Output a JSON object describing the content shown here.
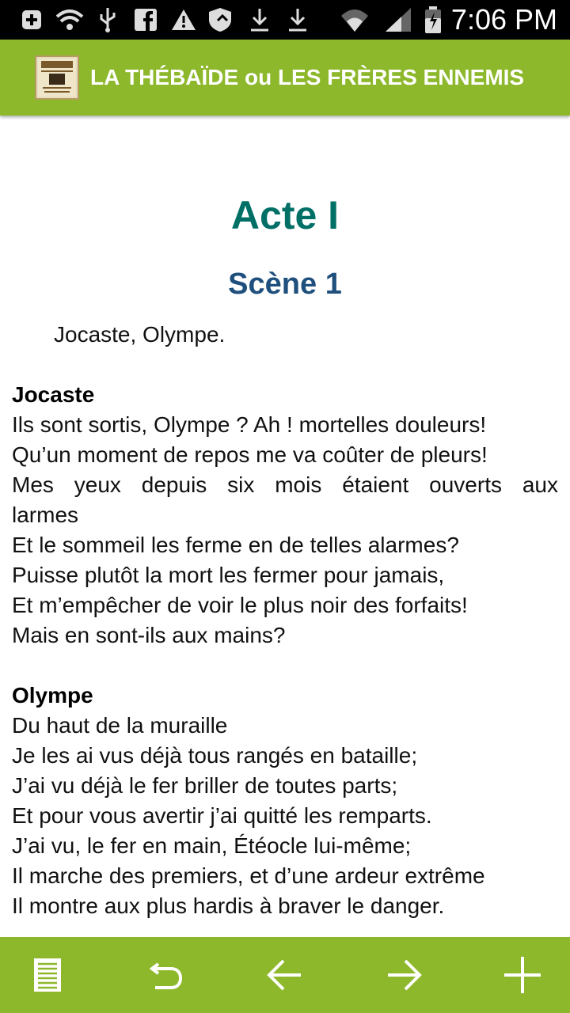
{
  "status_bar": {
    "time": "7:06 PM",
    "icons": [
      "plus-notification-icon",
      "wifi-hotspot-icon",
      "usb-icon",
      "facebook-icon",
      "warning-icon",
      "shield-icon",
      "download-icon",
      "download-icon",
      "wifi-icon",
      "signal-icon",
      "battery-icon"
    ]
  },
  "app_bar": {
    "title": "LA THÉBAÏDE ou LES FRÈRES ENNEMIS",
    "icon": "book-cover-icon"
  },
  "content": {
    "act": "Acte I",
    "scene": "Scène 1",
    "cast": "Jocaste, Olympe.",
    "speeches": [
      {
        "speaker": "Jocaste",
        "lines": [
          "Ils sont sortis, Olympe ? Ah ! mortelles douleurs!",
          "Qu’un moment de repos me va coûter de pleurs!",
          "Mes yeux depuis six mois étaient ouverts aux",
          "larmes",
          "Et le sommeil les ferme en de telles alarmes?",
          "Puisse plutôt la mort les fermer pour jamais,",
          "Et m’empêcher de voir le plus noir des forfaits!",
          "Mais en sont-ils aux mains?"
        ]
      },
      {
        "speaker": "Olympe",
        "lines": [
          "Du haut de la muraille",
          "Je les ai vus déjà tous rangés en bataille;",
          "J’ai vu déjà le fer briller de toutes parts;",
          "Et pour vous avertir j’ai quitté les remparts.",
          "J’ai vu, le fer en main, Étéocle lui-même;",
          "Il marche des premiers, et d’une ardeur extrême",
          "Il montre aux plus hardis à braver le danger."
        ]
      }
    ]
  },
  "bottom_bar": {
    "buttons": [
      "contents-icon",
      "undo-icon",
      "arrow-left-icon",
      "arrow-right-icon",
      "plus-icon"
    ]
  },
  "colors": {
    "accent": "#8db82c",
    "act_title": "#007066",
    "scene_title": "#1f4f7d"
  }
}
